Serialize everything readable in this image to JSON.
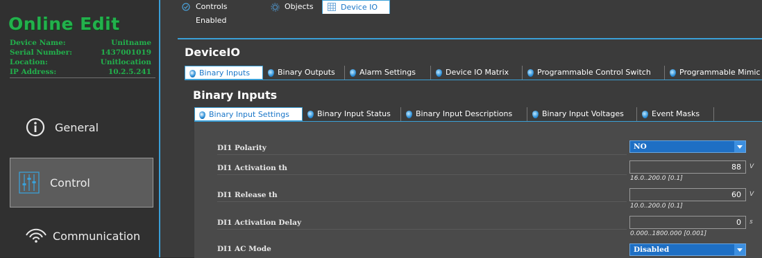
{
  "sidebar": {
    "brand": "Online Edit",
    "info": [
      {
        "label": "Device Name:",
        "value": "Unitname"
      },
      {
        "label": "Serial Number:",
        "value": "1437001019"
      },
      {
        "label": "Location:",
        "value": "Unitlocation"
      },
      {
        "label": "IP Address:",
        "value": "10.2.5.241"
      }
    ],
    "nav": [
      {
        "label": "General",
        "icon": "info-icon",
        "active": false
      },
      {
        "label": "Control",
        "icon": "sliders-icon",
        "active": true
      },
      {
        "label": "Communication",
        "icon": "wireless-icon",
        "active": false
      }
    ]
  },
  "top_tabs": [
    {
      "label": "Controls Enabled",
      "icon": "check-circle-icon",
      "active": false
    },
    {
      "label": "Objects",
      "icon": "gear-icon",
      "active": false
    },
    {
      "label": "Device IO",
      "icon": "grid-icon",
      "active": true
    }
  ],
  "device_title": "DeviceIO",
  "device_tabs": [
    {
      "label": "Binary Inputs",
      "active": true
    },
    {
      "label": "Binary Outputs",
      "active": false
    },
    {
      "label": "Alarm Settings",
      "active": false
    },
    {
      "label": "Device IO Matrix",
      "active": false
    },
    {
      "label": "Programmable Control Switch",
      "active": false
    },
    {
      "label": "Programmable Mimic",
      "active": false
    }
  ],
  "section_title": "Binary Inputs",
  "section_tabs": [
    {
      "label": "Binary Input Settings",
      "active": true
    },
    {
      "label": "Binary Input Status",
      "active": false
    },
    {
      "label": "Binary Input Descriptions",
      "active": false
    },
    {
      "label": "Binary Input Voltages",
      "active": false
    },
    {
      "label": "Event Masks",
      "active": false
    }
  ],
  "params": [
    {
      "label": "DI1 Polarity",
      "type": "select",
      "value": "NO"
    },
    {
      "label": "DI1 Activation th",
      "type": "number",
      "value": "88",
      "unit": "V",
      "range": "16.0..200.0 [0.1]"
    },
    {
      "label": "DI1 Release th",
      "type": "number",
      "value": "60",
      "unit": "V",
      "range": "10.0..200.0 [0.1]"
    },
    {
      "label": "DI1 Activation Delay",
      "type": "number",
      "value": "0",
      "unit": "s",
      "range": "0.000..1800.000 [0.001]"
    },
    {
      "label": "DI1 AC Mode",
      "type": "select",
      "value": "Disabled"
    }
  ],
  "colors": {
    "accent": "#3aa0d8",
    "brand_green": "#22b14c",
    "select_blue": "#1e6fc4"
  }
}
